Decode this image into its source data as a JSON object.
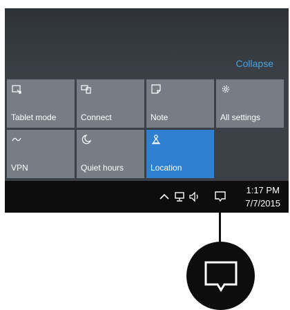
{
  "action_center": {
    "collapse_label": "Collapse"
  },
  "tiles": [
    {
      "label": "Tablet mode",
      "icon": "tablet-mode-icon",
      "active": false
    },
    {
      "label": "Connect",
      "icon": "connect-icon",
      "active": false
    },
    {
      "label": "Note",
      "icon": "note-icon",
      "active": false
    },
    {
      "label": "All settings",
      "icon": "gear-icon",
      "active": false
    },
    {
      "label": "VPN",
      "icon": "vpn-icon",
      "active": false
    },
    {
      "label": "Quiet hours",
      "icon": "moon-icon",
      "active": false
    },
    {
      "label": "Location",
      "icon": "location-icon",
      "active": true
    }
  ],
  "taskbar": {
    "time": "1:17 PM",
    "date": "7/7/2015",
    "tray_icons": [
      "chevron-up-icon",
      "network-icon",
      "volume-icon",
      "action-center-icon"
    ]
  },
  "callout": {
    "icon": "action-center-icon"
  },
  "colors": {
    "accent": "#4aa3df",
    "tile": "#777d85",
    "tile_active": "#2f80d1",
    "taskbar": "#0d0d0d"
  }
}
